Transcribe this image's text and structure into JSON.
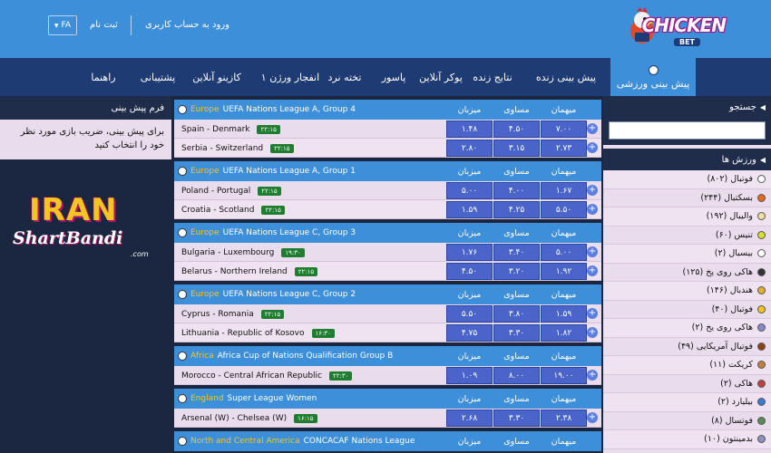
{
  "header": {
    "logo_text": "CHICKEN",
    "logo_sub": "BET",
    "login": "ورود به حساب کاربری",
    "register": "ثبت نام",
    "lang": "FA"
  },
  "nav": {
    "items": [
      "پیش بینی ورزشی",
      "پیش بینی زنده",
      "نتایج زنده",
      "پوکر آنلاین",
      "پاسور",
      "تخته نرد",
      "انفجار ورژن ۱",
      "کازینو آنلاین",
      "پشتیبانی",
      "راهنما"
    ]
  },
  "rightbar": {
    "search_title": "جستجو",
    "search_placeholder": "",
    "sports_title": "ورزش ها",
    "sports": [
      {
        "label": "فوتبال (۸۰۲)",
        "icon": "soccer-ball-icon",
        "color": "#ffffff"
      },
      {
        "label": "بسکتبال (۲۴۴)",
        "icon": "basketball-icon",
        "color": "#e56a1c"
      },
      {
        "label": "والیبال (۱۹۲)",
        "icon": "volleyball-icon",
        "color": "#f0e0a0"
      },
      {
        "label": "تنیس (۶۰)",
        "icon": "tennis-ball-icon",
        "color": "#d5e02a"
      },
      {
        "label": "بیسبال (۲)",
        "icon": "baseball-icon",
        "color": "#ffffff"
      },
      {
        "label": "هاکی روی یخ (۱۲۵)",
        "icon": "ice-hockey-icon",
        "color": "#333333"
      },
      {
        "label": "هندبال (۱۴۶)",
        "icon": "handball-icon",
        "color": "#e0b030"
      },
      {
        "label": "فوتبال (۴۰)",
        "icon": "futsal-icon",
        "color": "#f4c521"
      },
      {
        "label": "هاکی روی یخ (۲)",
        "icon": "ice-hockey-stick-icon",
        "color": "#8888cc"
      },
      {
        "label": "فوتبال آمریکایی (۴۹)",
        "icon": "american-football-icon",
        "color": "#8b4513"
      },
      {
        "label": "کریکت (۱۱)",
        "icon": "cricket-icon",
        "color": "#c08040"
      },
      {
        "label": "هاکی (۲)",
        "icon": "hockey-icon",
        "color": "#c04040"
      },
      {
        "label": "بیلیارد (۲)",
        "icon": "billiard-icon",
        "color": "#3a7bd5"
      },
      {
        "label": "فوتسال (۸)",
        "icon": "futsal-ball-icon",
        "color": "#5a8a5a"
      },
      {
        "label": "بدمینتون (۱۰)",
        "icon": "badminton-icon",
        "color": "#9090c0"
      }
    ]
  },
  "leftbar": {
    "form_title": "فرم پیش بینی",
    "form_msg": "برای پیش بینی، ضریب بازی مورد نظر خود را انتخاب کنید",
    "brand_top": "IRAN",
    "brand_bottom": "ShartBandi",
    "brand_suffix": ".com"
  },
  "columns": {
    "host": "میزبان",
    "draw": "مساوی",
    "guest": "میهمان"
  },
  "blocks": [
    {
      "region": "Europe",
      "league": "UEFA Nations League A, Group 4",
      "matches": [
        {
          "teams": "Spain  -  Denmark",
          "time": "۲۲:۱۵",
          "host": "۱.۴۸",
          "draw": "۴.۵۰",
          "guest": "۷.۰۰"
        },
        {
          "teams": "Serbia  -  Switzerland",
          "time": "۲۲:۱۵",
          "host": "۲.۸۰",
          "draw": "۳.۱۵",
          "guest": "۲.۷۳"
        }
      ]
    },
    {
      "region": "Europe",
      "league": "UEFA Nations League A, Group 1",
      "matches": [
        {
          "teams": "Poland  -  Portugal",
          "time": "۲۲:۱۵",
          "host": "۵.۰۰",
          "draw": "۴.۰۰",
          "guest": "۱.۶۷"
        },
        {
          "teams": "Croatia  -  Scotland",
          "time": "۲۲:۱۵",
          "host": "۱.۵۹",
          "draw": "۴.۲۵",
          "guest": "۵.۵۰"
        }
      ]
    },
    {
      "region": "Europe",
      "league": "UEFA Nations League C, Group 3",
      "matches": [
        {
          "teams": "Bulgaria  -  Luxembourg",
          "time": "۱۹:۳۰",
          "host": "۱.۷۶",
          "draw": "۳.۴۰",
          "guest": "۵.۰۰"
        },
        {
          "teams": "Belarus  -  Northern Ireland",
          "time": "۲۲:۱۵",
          "host": "۴.۵۰",
          "draw": "۳.۲۰",
          "guest": "۱.۹۲"
        }
      ]
    },
    {
      "region": "Europe",
      "league": "UEFA Nations League C, Group 2",
      "matches": [
        {
          "teams": "Cyprus  -  Romania",
          "time": "۲۲:۱۵",
          "host": "۵.۵۰",
          "draw": "۳.۸۰",
          "guest": "۱.۵۹"
        },
        {
          "teams": "Lithuania  -  Republic of Kosovo",
          "time": "۱۶:۳۰",
          "host": "۴.۷۵",
          "draw": "۳.۳۰",
          "guest": "۱.۸۲"
        }
      ]
    },
    {
      "region": "Africa",
      "league": "Africa Cup of Nations Qualification Group B",
      "matches": [
        {
          "teams": "Morocco  -  Central African Republic",
          "time": "۲۲:۳۰",
          "host": "۱.۰۹",
          "draw": "۸.۰۰",
          "guest": "۱۹.۰۰"
        }
      ]
    },
    {
      "region": "England",
      "league": "Super League Women",
      "matches": [
        {
          "teams": "Arsenal (W)  -  Chelsea (W)",
          "time": "۱۶:۱۵",
          "host": "۲.۶۸",
          "draw": "۳.۳۰",
          "guest": "۲.۳۸"
        }
      ]
    },
    {
      "region": "North and Central America",
      "league": "CONCACAF Nations League",
      "matches": []
    }
  ]
}
